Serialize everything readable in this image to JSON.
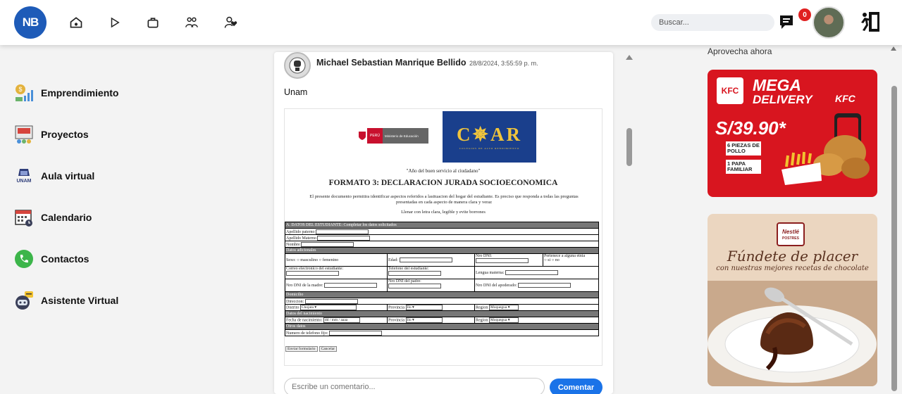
{
  "topbar": {
    "logo_text": "NB",
    "nav_icons": [
      "home-icon",
      "play-icon",
      "bag-icon",
      "group-icon",
      "user-heart-icon"
    ],
    "search_placeholder": "Buscar...",
    "notification_count": "0"
  },
  "sidebar": {
    "items": [
      {
        "label": "Emprendimiento",
        "icon": "entrepreneurship-icon"
      },
      {
        "label": "Proyectos",
        "icon": "projects-icon"
      },
      {
        "label": "Aula virtual",
        "icon": "unam-icon",
        "icon_text": "UNAM"
      },
      {
        "label": "Calendario",
        "icon": "calendar-icon"
      },
      {
        "label": "Contactos",
        "icon": "phone-icon"
      },
      {
        "label": "Asistente Virtual",
        "icon": "robot-icon"
      }
    ]
  },
  "post": {
    "author": "Michael Sebastian Manrique Bellido",
    "time": "28/8/2024, 3:55:59 p. m.",
    "text": "Unam",
    "doc": {
      "peru_label": "PERÚ",
      "ministry": "Ministerio de Educación",
      "coar": "C✵AR",
      "coar_sub": "COLEGIOS DE ALTO RENDIMIENTO",
      "year": "\"Año del buen servicio al ciudadano\"",
      "title": "FORMATO 3: DECLARACION JURADA SOCIOECONOMICA",
      "intro": "El presente documento permitira identificar aspectos referidos a lasituacion del hogar del estudiante. Es preciso que responda a todas las preguntas presentadas en cada aspecto de manera clara y veraz",
      "instructions": "Llenar con letra clara, legible y evite borrones",
      "sec_a": "A. DATOS DEL ESTUDIANTE: Completar los datos solicitados",
      "apellido_paterno": "Apellido paterno",
      "apellido_materno": "Apellido Materno",
      "nombre": "Nombre",
      "sec_adicionales": "Datos adicionales",
      "sexo": "Sexo:",
      "masculino": "○ masculino",
      "femenino": "○ femenino",
      "edad": "Edad:",
      "nro_dni": "Nro DNI:",
      "etnia": "Pertenece a alguna etnia",
      "si_no": "○ si ○ no",
      "correo": "Correo electronico del estudiante:",
      "telefono_est": "Telefono del estudiante:",
      "lengua": "Lengua materna:",
      "dni_madre": "Nro DNI de la madre:",
      "dni_padre": "Nro DNI del padre:",
      "dni_apoderado": "Nro DNI del apoderado:",
      "sec_domicilio": "Domicilio",
      "direccion": "Direccion:",
      "distrito": "Distrito",
      "distrito_val": "Chojata",
      "provincia": "Provincia",
      "provincia_val": "Ilo",
      "region": "Region",
      "region_val": "Moquegua",
      "sec_nacimiento": "Datos del nacimiento",
      "fecha_nac": "Fecha de nacimiento:",
      "fecha_val": "dd / mm / aaaa",
      "sec_otros": "Otros datos",
      "telefono_fijo": "Numero de telefono fijo:",
      "enviar": "Enviar formulario",
      "cancelar": "Cancelar"
    },
    "comment_placeholder": "Escribe un comentario...",
    "comment_button": "Comentar"
  },
  "ads": {
    "title": "Aprovecha ahora",
    "kfc": {
      "mega": "MEGA",
      "delivery": "DELIVERY",
      "price": "S/39.90*",
      "box1": "6 PIEZAS DE POLLO",
      "box2": "1 PAPA FAMILIAR",
      "brand": "KFC",
      "logo": "KFC"
    },
    "nestle": {
      "brand": "Nestlé",
      "line": "POSTRES",
      "title": "Fúndete de placer",
      "subtitle": "con nuestras mejores recetas de chocolate"
    }
  },
  "colors": {
    "brand_blue": "#1e5bb8",
    "comment_button": "#1a73e8",
    "kfc_red": "#d8151f",
    "badge_red": "#e02020"
  }
}
